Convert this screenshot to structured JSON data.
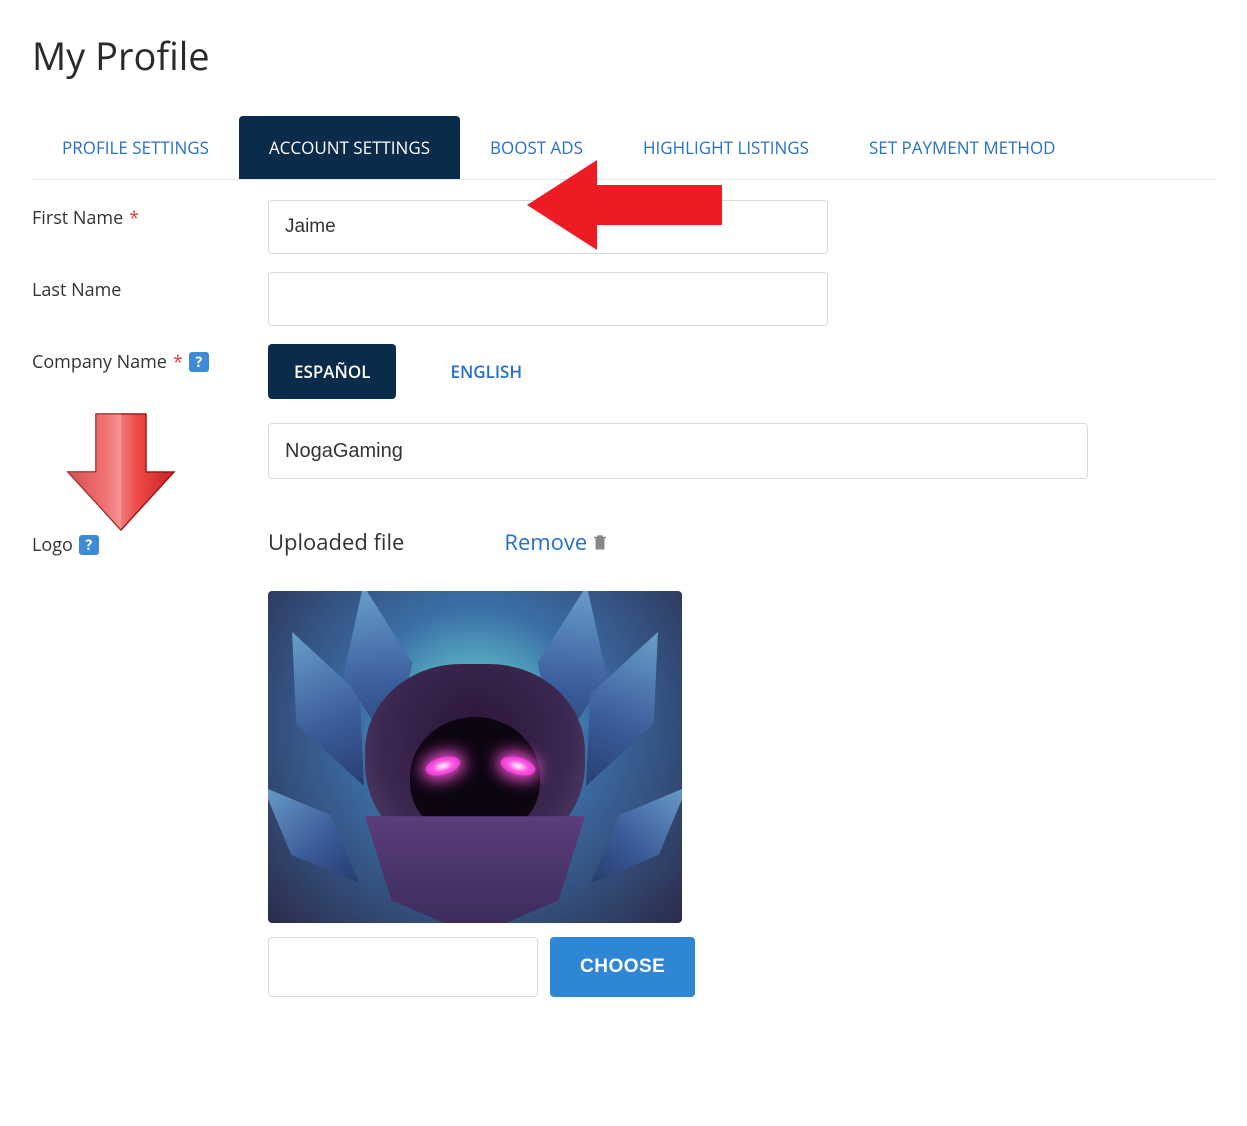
{
  "page": {
    "title": "My Profile"
  },
  "tabs": [
    {
      "label": "PROFILE SETTINGS",
      "active": false
    },
    {
      "label": "ACCOUNT SETTINGS",
      "active": true
    },
    {
      "label": "BOOST ADS",
      "active": false
    },
    {
      "label": "HIGHLIGHT LISTINGS",
      "active": false
    },
    {
      "label": "SET PAYMENT METHOD",
      "active": false
    }
  ],
  "form": {
    "first_name": {
      "label": "First Name",
      "required": "*",
      "value": "Jaime"
    },
    "last_name": {
      "label": "Last Name",
      "value": ""
    },
    "company_name": {
      "label": "Company Name",
      "required": "*",
      "value": "NogaGaming"
    },
    "logo": {
      "label": "Logo",
      "uploaded_text": "Uploaded file",
      "remove_text": "Remove",
      "choose_text": "CHOOSE"
    }
  },
  "lang_tabs": {
    "es": "ESPAÑOL",
    "en": "ENGLISH"
  },
  "help": {
    "glyph": "?"
  },
  "annotations": {
    "arrow_color": "#ed1c24"
  }
}
